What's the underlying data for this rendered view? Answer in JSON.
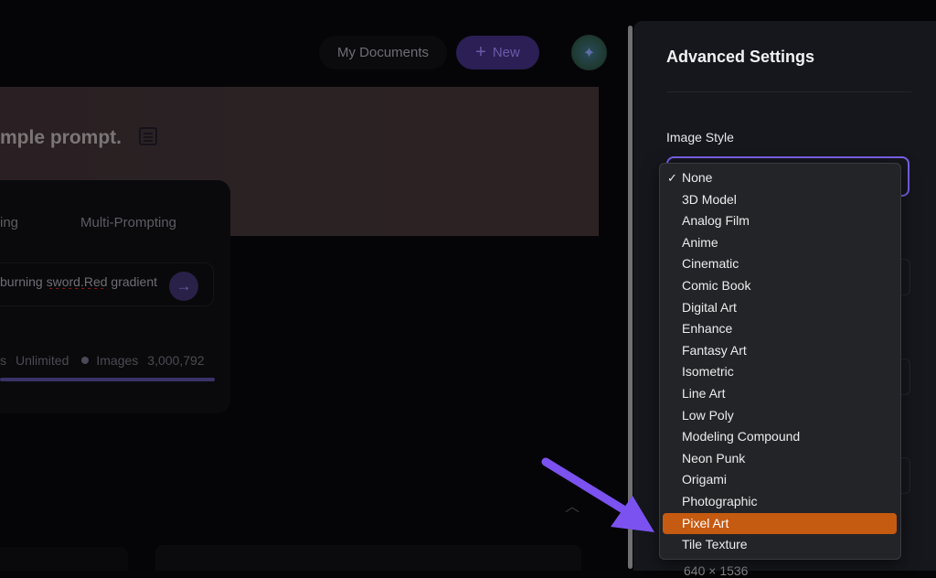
{
  "header": {
    "docs_label": "My Documents",
    "new_label": "New"
  },
  "hero": {
    "title": "mple prompt."
  },
  "tabs": [
    "ing",
    "Multi-Prompting"
  ],
  "prompt": {
    "text_a": "burning ",
    "text_b": "sword.Red",
    "text_c": " gradient"
  },
  "stats": {
    "a": "s",
    "b": "Unlimited",
    "c": "Images",
    "d": "3,000,792"
  },
  "settings": {
    "title": "Advanced Settings",
    "image_style_label": "Image Style",
    "bottom_value": "640 × 1536"
  },
  "dropdown": {
    "selected": "None",
    "highlighted": "Pixel Art",
    "options": [
      "None",
      "3D Model",
      "Analog Film",
      "Anime",
      "Cinematic",
      "Comic Book",
      "Digital Art",
      "Enhance",
      "Fantasy Art",
      "Isometric",
      "Line Art",
      "Low Poly",
      "Modeling Compound",
      "Neon Punk",
      "Origami",
      "Photographic",
      "Pixel Art",
      "Tile Texture"
    ]
  },
  "colors": {
    "accent": "#7a60e8",
    "highlight": "#c55a11",
    "annotation_arrow": "#7b52f0"
  }
}
